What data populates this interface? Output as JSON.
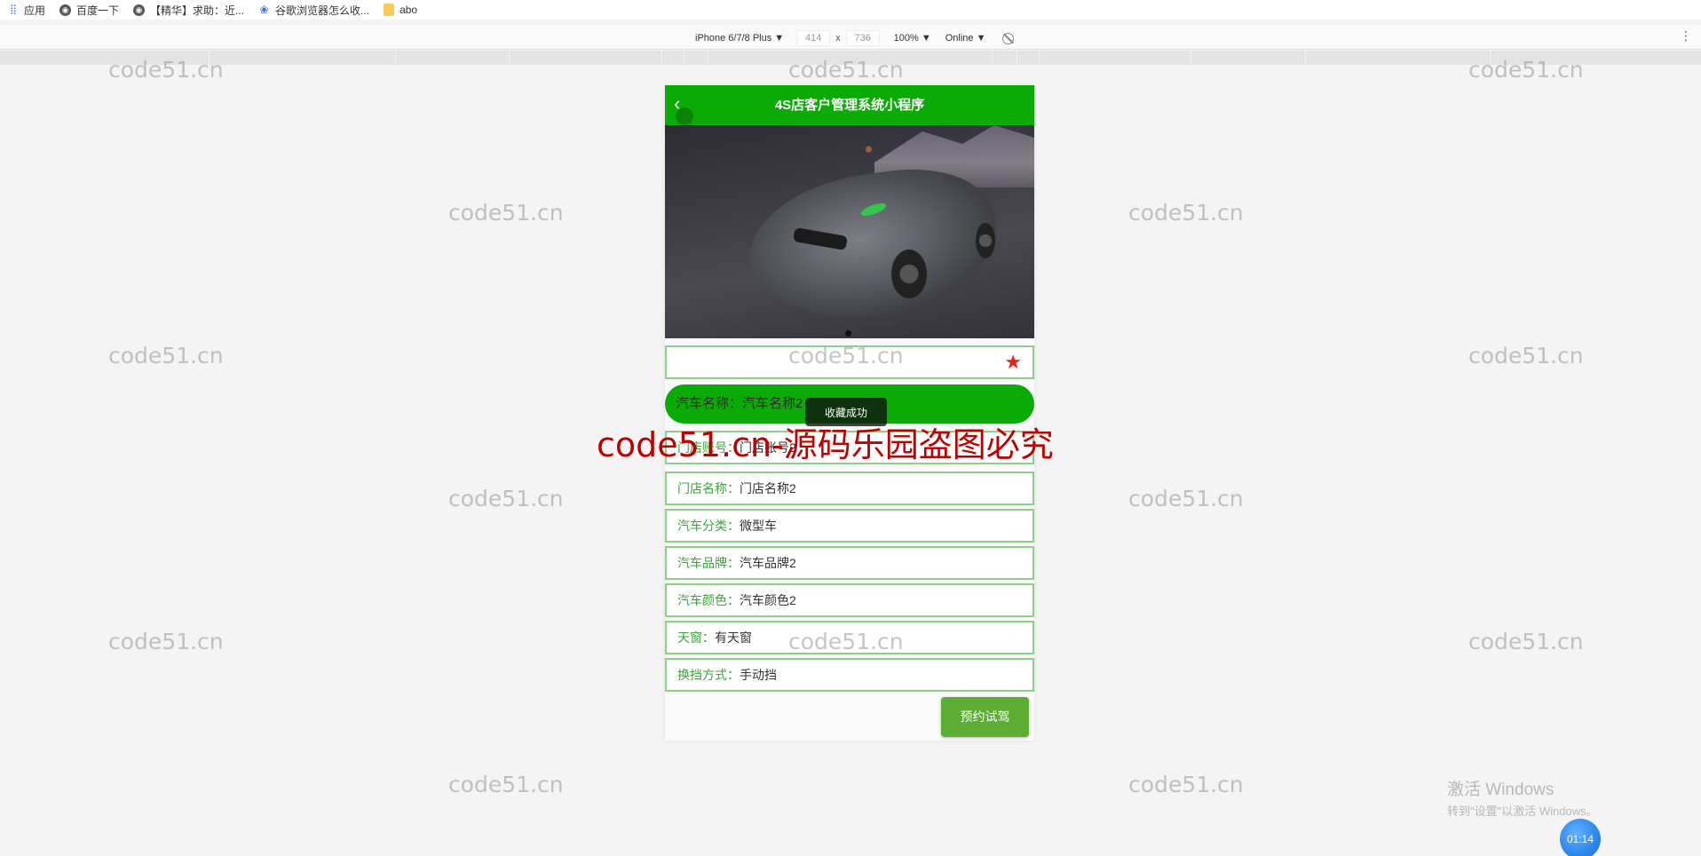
{
  "browser": {
    "bookmarks": [
      {
        "icon": "apps-grid-icon",
        "label": "应用"
      },
      {
        "icon": "globe-icon",
        "label": "百度一下"
      },
      {
        "icon": "globe-icon",
        "label": "【精华】求助：近..."
      },
      {
        "icon": "baidu-paw-icon",
        "label": "谷歌浏览器怎么收..."
      },
      {
        "icon": "folder-icon",
        "label": "abo"
      }
    ],
    "device_toolbar": {
      "device": "iPhone 6/7/8 Plus ▼",
      "width": "414",
      "times": "x",
      "height": "736",
      "zoom": "100% ▼",
      "network": "Online ▼",
      "more": "⋮"
    }
  },
  "app": {
    "title": "4S店客户管理系统小程序",
    "back_icon": "‹",
    "favorite_icon": "★",
    "toast": "收藏成功",
    "fields": [
      {
        "label": "汽车名称：",
        "value": "汽车名称2"
      },
      {
        "label": "门店账号：",
        "value": "门店账号2"
      },
      {
        "label": "门店名称：",
        "value": "门店名称2"
      },
      {
        "label": "汽车分类：",
        "value": "微型车"
      },
      {
        "label": "汽车品牌：",
        "value": "汽车品牌2"
      },
      {
        "label": "汽车颜色：",
        "value": "汽车颜色2"
      },
      {
        "label": "天窗：",
        "value": "有天窗"
      },
      {
        "label": "换挡方式：",
        "value": "手动挡"
      }
    ],
    "book_button": "预约试驾",
    "colors": {
      "primary": "#0bab05",
      "label": "#3aa63a",
      "border": "#8ed08a",
      "star": "#e8231b",
      "button": "#5cad34"
    }
  },
  "watermarks": {
    "text": "code51.cn",
    "banner": "code51.cn-源码乐园盗图必究"
  },
  "system": {
    "activate_title": "激活 Windows",
    "activate_sub": "转到\"设置\"以激活 Windows。",
    "timer": "01:14"
  }
}
